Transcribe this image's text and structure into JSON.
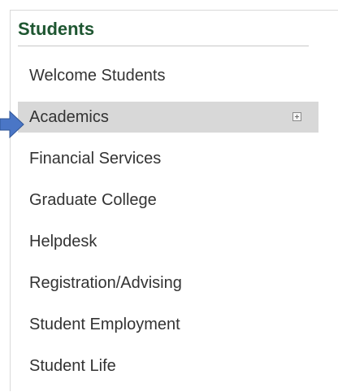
{
  "panel": {
    "title": "Students"
  },
  "nav": {
    "items": [
      {
        "label": "Welcome Students"
      },
      {
        "label": "Academics",
        "active": true,
        "expandable": true
      },
      {
        "label": "Financial Services"
      },
      {
        "label": "Graduate College"
      },
      {
        "label": "Helpdesk"
      },
      {
        "label": "Registration/Advising"
      },
      {
        "label": "Student Employment"
      },
      {
        "label": "Student Life"
      }
    ]
  },
  "icons": {
    "expand": "plus-box-icon",
    "pointer": "arrow-right-icon"
  },
  "colors": {
    "title": "#1e5631",
    "active_background": "#d8d8d8",
    "pointer_arrow": "#4a76c6"
  }
}
